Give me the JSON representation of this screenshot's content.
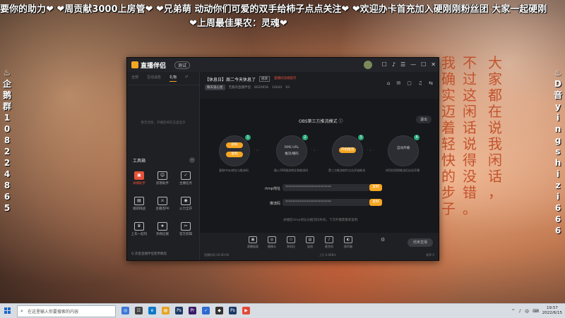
{
  "overlay": {
    "marquee": "要你的助力❤ ❤周贡献3000上房管❤ ❤兄弟萌 动动你们可爱的双手给柿子点点关注❤ ❤欢迎办卡首充加入硬刚刚粉丝团 大家一起硬刚",
    "week_best": "❤上周最佳果农：灵魂❤",
    "left_vertical": [
      "♨",
      "企",
      "鹅",
      "群",
      "1",
      "0",
      "8",
      "2",
      "2",
      "4",
      "8",
      "6",
      "5"
    ],
    "right_vertical": [
      "♨",
      "D",
      "音",
      "y",
      "i",
      "n",
      "g",
      "s",
      "h",
      "i",
      "z",
      "i",
      "6",
      "6",
      "6"
    ],
    "poem_cols": [
      [
        "我",
        "确",
        "实",
        "迈",
        "着",
        "轻",
        "快",
        "的",
        "步",
        "子"
      ],
      [
        "不",
        "过",
        "这",
        "闲",
        "话",
        "说",
        "得",
        "没",
        "错",
        "。"
      ],
      [
        "大",
        "家",
        "都",
        "在",
        "说",
        "我",
        "闲",
        "话",
        "，"
      ]
    ]
  },
  "app": {
    "title": "直播伴侣",
    "version_badge": "测试",
    "titlebar_icons": [
      "☐",
      "♪",
      "☰",
      "—",
      "☐",
      "✕"
    ],
    "left_tabs": [
      "全部",
      "互动消息",
      "礼物",
      "⇄"
    ],
    "active_tab": 2,
    "empty_hint": "暂无消息，开播后将在这里显示",
    "tools_title": "工具箱",
    "tools_more": "···",
    "tools": [
      {
        "icon": "▣",
        "label": "录播助手",
        "on": true
      },
      {
        "icon": "☺",
        "label": "房管助手",
        "on": false
      },
      {
        "icon": "✓",
        "label": "主播任务",
        "on": false
      },
      {
        "icon": "▤",
        "label": "福袋挑战",
        "on": false
      },
      {
        "icon": "⚔",
        "label": "主播连PK",
        "on": false
      },
      {
        "icon": "◉",
        "label": "火力全开",
        "on": false
      },
      {
        "icon": "♛",
        "label": "上车一起玩",
        "on": false
      },
      {
        "icon": "★",
        "label": "热榜应援",
        "on": false
      },
      {
        "icon": "✂",
        "label": "官方剪辑",
        "on": false
      }
    ],
    "bottom_tip": "Q 热度直播伴侣使用教程",
    "room_title": "【休息日】周二今天休息了",
    "tag_edit": "修改",
    "tag_red": "直播间违规提示",
    "room_meta": {
      "category": "聊天谈心星",
      "host": "无敌的直播伴侣",
      "id": "8020958",
      "fans": "14644",
      "likes": "93"
    },
    "main_icons": [
      "⌂",
      "✉",
      "▢",
      "♫",
      "⇆"
    ],
    "mode_title": "OBS第三方推流模式 ⓘ",
    "exit_label": "退出",
    "steps": [
      {
        "num": "1",
        "t1": "",
        "t2": "",
        "pill_a": "获取",
        "pill_b": "复制",
        "desc": "复制rtmp地址与推流码"
      },
      {
        "num": "2",
        "t1": "RMS URL",
        "t2": "推流/播码",
        "pill_a": "",
        "pill_b": "",
        "desc": "填入OBS推流地址和推流码"
      },
      {
        "num": "3",
        "t1": "",
        "t2": "",
        "pill_a": "开始推流",
        "pill_b": "",
        "desc": "第三方推流软件点击开始推流"
      },
      {
        "num": "4",
        "t1": "自动开播",
        "t2": "",
        "pill_a": "",
        "pill_b": "",
        "desc": "伴侣检测到推流后自动开播"
      }
    ],
    "rtmp_label": "rtmp地址",
    "rtmp_value": "**************************",
    "key_label": "推流码",
    "key_value": "**************************",
    "copy_label": "复制",
    "note": "关播后rtmp地址与推流码失效，下次开播需重新复制",
    "controls": [
      {
        "icon": "▣",
        "label": "直播画面"
      },
      {
        "icon": "◎",
        "label": "摄像头"
      },
      {
        "icon": "▭",
        "label": "多机位"
      },
      {
        "icon": "▤",
        "label": "连线"
      },
      {
        "icon": "♪",
        "label": "麦克风"
      },
      {
        "icon": "◐",
        "label": "扬声器"
      }
    ],
    "settings_icon": "⚙",
    "live_label": "结束直播",
    "status_left": "直播时间 00:00:00",
    "status_mid": "上行 0.0KB/s",
    "status_right": "帧率 0"
  },
  "taskbar": {
    "search_placeholder": "在这里输入你要搜索的内容",
    "apps": [
      {
        "icon": "◎",
        "color": "#3b78d8"
      },
      {
        "icon": "☷",
        "color": "#444"
      },
      {
        "icon": "e",
        "color": "#0f7ac6"
      },
      {
        "icon": "▤",
        "color": "#e6a323"
      },
      {
        "icon": "Ps",
        "color": "#1c3a66"
      },
      {
        "icon": "Pr",
        "color": "#3a1c66"
      },
      {
        "icon": "✓",
        "color": "#2e6ad1"
      },
      {
        "icon": "◆",
        "color": "#333"
      },
      {
        "icon": "Ps",
        "color": "#1c3a66"
      },
      {
        "icon": "▶",
        "color": "#e04a3a"
      }
    ],
    "tray": [
      "^",
      "♪",
      "中",
      "⌨"
    ],
    "time": "19:57",
    "date": "2022/6/15"
  }
}
